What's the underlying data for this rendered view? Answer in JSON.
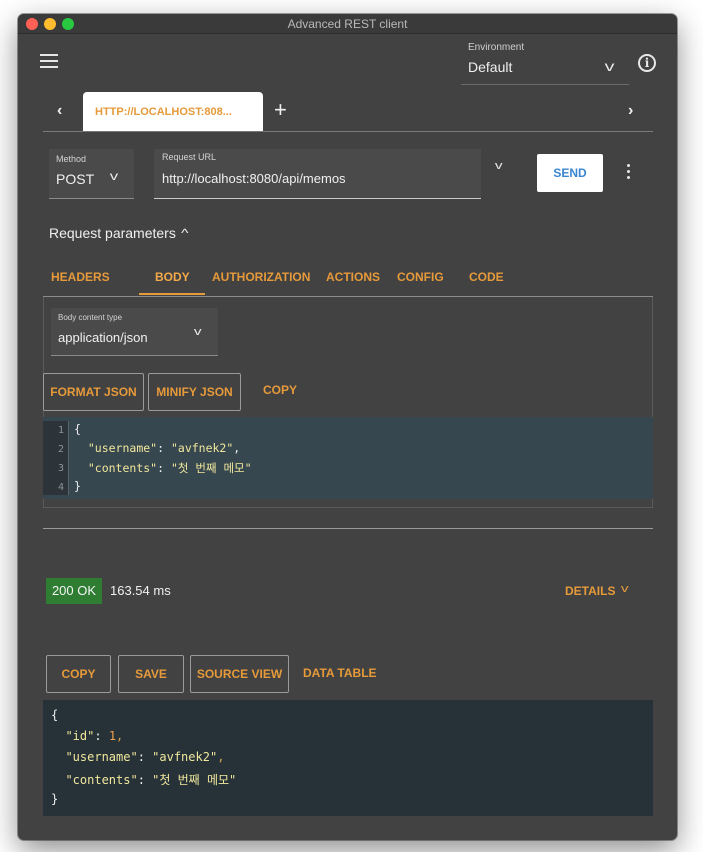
{
  "window": {
    "title": "Advanced REST client"
  },
  "appbar": {
    "menu_icon": "hamburger-menu-icon",
    "environment_label": "Environment",
    "environment_value": "Default",
    "info_icon": "info-icon"
  },
  "tabs": {
    "active_tab_label": "HTTP://LOCALHOST:808...",
    "add_label": "+",
    "prev_label": "‹",
    "next_label": "›"
  },
  "request": {
    "method_label": "Method",
    "method_value": "POST",
    "url_label": "Request URL",
    "url_value": "http://localhost:8080/api/memos",
    "send_label": "SEND"
  },
  "params": {
    "title": "Request parameters",
    "tabs": [
      "HEADERS",
      "BODY",
      "AUTHORIZATION",
      "ACTIONS",
      "CONFIG",
      "CODE"
    ],
    "active_tab": "BODY"
  },
  "body": {
    "content_type_label": "Body content type",
    "content_type_value": "application/json",
    "format_json_label": "FORMAT JSON",
    "minify_json_label": "MINIFY JSON",
    "copy_label": "COPY",
    "line_numbers": [
      "1",
      "2",
      "3",
      "4"
    ],
    "line1": "{",
    "line2_key": "\"username\"",
    "line2_sep": ": ",
    "line2_value": "\"avfnek2\"",
    "line2_end": ",",
    "line3_key": "\"contents\"",
    "line3_sep": ": ",
    "line3_value": "\"첫 번째 메모\"",
    "line4": "}"
  },
  "response": {
    "status": "200 OK",
    "time": "163.54 ms",
    "details_label": "DETAILS",
    "copy_label": "COPY",
    "save_label": "SAVE",
    "source_view_label": "SOURCE VIEW",
    "data_table_label": "DATA TABLE",
    "open_brace": "{",
    "id_key": "\"id\"",
    "id_value": "1",
    "username_key": "\"username\"",
    "username_value": "\"avfnek2\"",
    "contents_key": "\"contents\"",
    "contents_value": "\"첫 번째 메모\"",
    "close_brace": "}"
  },
  "colors": {
    "accent": "#e69a3a",
    "status_ok": "#2e7d32",
    "send_text": "#3a86d1",
    "background": "#424242"
  }
}
